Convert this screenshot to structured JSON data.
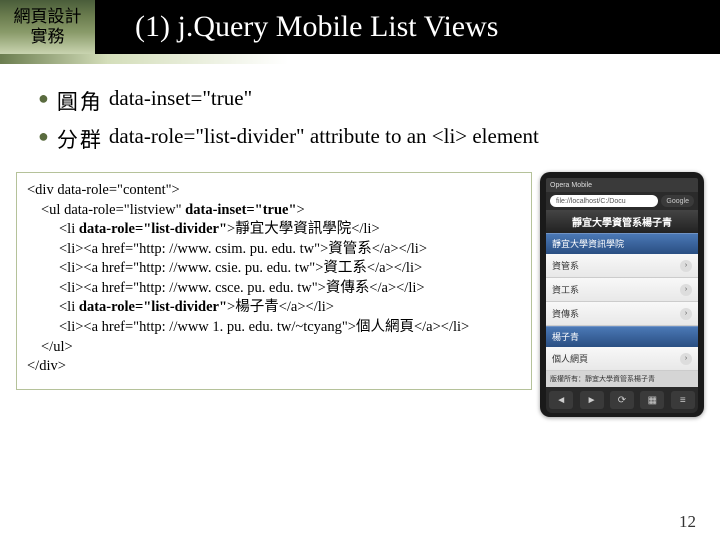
{
  "header": {
    "left_line1": "網頁設計",
    "left_line2": "實務",
    "title": "(1) j.Query Mobile  List Views"
  },
  "bullets": [
    {
      "label": "圓角",
      "code": "data-inset=\"true\""
    },
    {
      "label": "分群",
      "code": "data-role=\"list-divider\" attribute to an <li> element"
    }
  ],
  "code": {
    "l0": "<div data-role=\"content\">",
    "l1_a": "<ul data-role=\"listview\" ",
    "l1_b": "data-inset=\"true\"",
    "l1_c": ">",
    "l2_a": "<li ",
    "l2_b": "data-role=\"list-divider\"",
    "l2_c": ">靜宜大學資訊學院</li>",
    "l3": "<li><a href=\"http: //www. csim. pu. edu. tw\">資管系</a></li>",
    "l4": "<li><a href=\"http: //www. csie. pu. edu. tw\">資工系</a></li>",
    "l5": "<li><a href=\"http: //www. csce. pu. edu. tw\">資傳系</a></li>",
    "l6_a": "<li ",
    "l6_b": "data-role=\"list-divider\"",
    "l6_c": ">楊子青</a></li>",
    "l7": "<li><a href=\"http: //www 1. pu. edu. tw/~tcyang\">個人網頁</a></li>",
    "l8": "</ul>",
    "l9": "</div>"
  },
  "phone": {
    "window_title": "Opera Mobile",
    "url": "file://localhost/C:/Docu",
    "url_btn": "Google",
    "app_title": "靜宜大學資管系楊子青",
    "divider1": "靜宜大學資訊學院",
    "items1": [
      "資管系",
      "資工系",
      "資傳系"
    ],
    "divider2": "楊子青",
    "items2": [
      "個人網頁"
    ],
    "footer": "版權所有：靜宜大學資管系楊子青",
    "nav_back": "◄",
    "nav_fwd": "►",
    "nav_reload": "⟳",
    "nav_tabs": "▦",
    "nav_menu": "≡"
  },
  "page_number": "12"
}
